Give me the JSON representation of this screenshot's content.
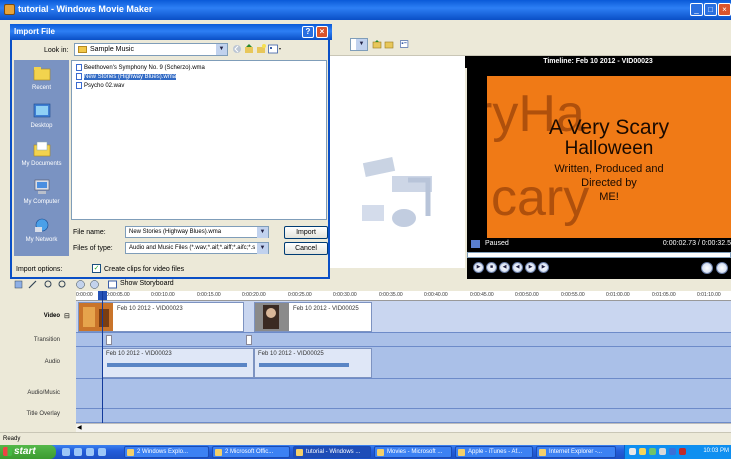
{
  "app": {
    "title": "tutorial - Windows Movie Maker"
  },
  "dialog": {
    "title": "Import File",
    "look_in_label": "Look in:",
    "look_in_value": "Sample Music",
    "places": [
      "Recent",
      "Desktop",
      "My Documents",
      "My Computer",
      "My Network"
    ],
    "files": [
      "Beethoven's Symphony No. 9 (Scherzo).wma",
      "New Stories (Highway Blues).wma",
      "Psycho 02.wav"
    ],
    "selected_file_index": 1,
    "file_name_label": "File name:",
    "file_name_value": "New Stories (Highway Blues).wma",
    "file_type_label": "Files of type:",
    "file_type_value": "Audio and Music Files (*.wav;*.aif;*.aiff;*.aifc;*.s",
    "import_button": "Import",
    "cancel_button": "Cancel",
    "import_options_label": "Import options:",
    "create_clips_label": "Create clips for video files",
    "create_clips_checked": true
  },
  "preview": {
    "title": "Timeline: Feb 10 2012 - VID00023",
    "frame_lines": [
      "A Very Scary",
      "Halloween",
      "Written, Produced and",
      "Directed by",
      "ME!"
    ],
    "ghost_text": "ryHa",
    "ghost_text2": "cary",
    "status": "Paused",
    "time": "0:00:02.73 / 0:00:32.5"
  },
  "timeline": {
    "show_storyboard": "Show Storyboard",
    "ticks": [
      "0:00:00",
      "0:00:05.00",
      "0:00:10.00",
      "0:00:15.00",
      "0:00:20.00",
      "0:00:25.00",
      "0:00:30.00",
      "0:00:35.00",
      "0:00:40.00",
      "0:00:45.00",
      "0:00:50.00",
      "0:00:55.00",
      "0:01:00.00",
      "0:01:05.00",
      "0:01:10.00"
    ],
    "tracks": [
      "Video",
      "Transition",
      "Audio",
      "Audio/Music",
      "Title Overlay"
    ],
    "video_clips": [
      "Feb 10 2012 - VID00023",
      "Feb 10 2012 - VID00025"
    ],
    "audio_clips": [
      "Feb 10 2012 - VID00023",
      "Feb 10 2012 - VID00025"
    ]
  },
  "statusbar": {
    "text": "Ready"
  },
  "taskbar": {
    "start": "start",
    "tasks": [
      "2 Windows Explo...",
      "2 Microsoft Offic...",
      "tutorial - Windows ...",
      "Movies - Microsoft ...",
      "Apple - iTunes - Af...",
      "Internet Explorer -..."
    ],
    "active_task_index": 2,
    "clock": "10:03 PM"
  },
  "colors": {
    "xp_blue": "#0a4fc6",
    "video_frame": "#f07a16",
    "selection": "#316ac5",
    "start_green": "#3b9b30"
  }
}
